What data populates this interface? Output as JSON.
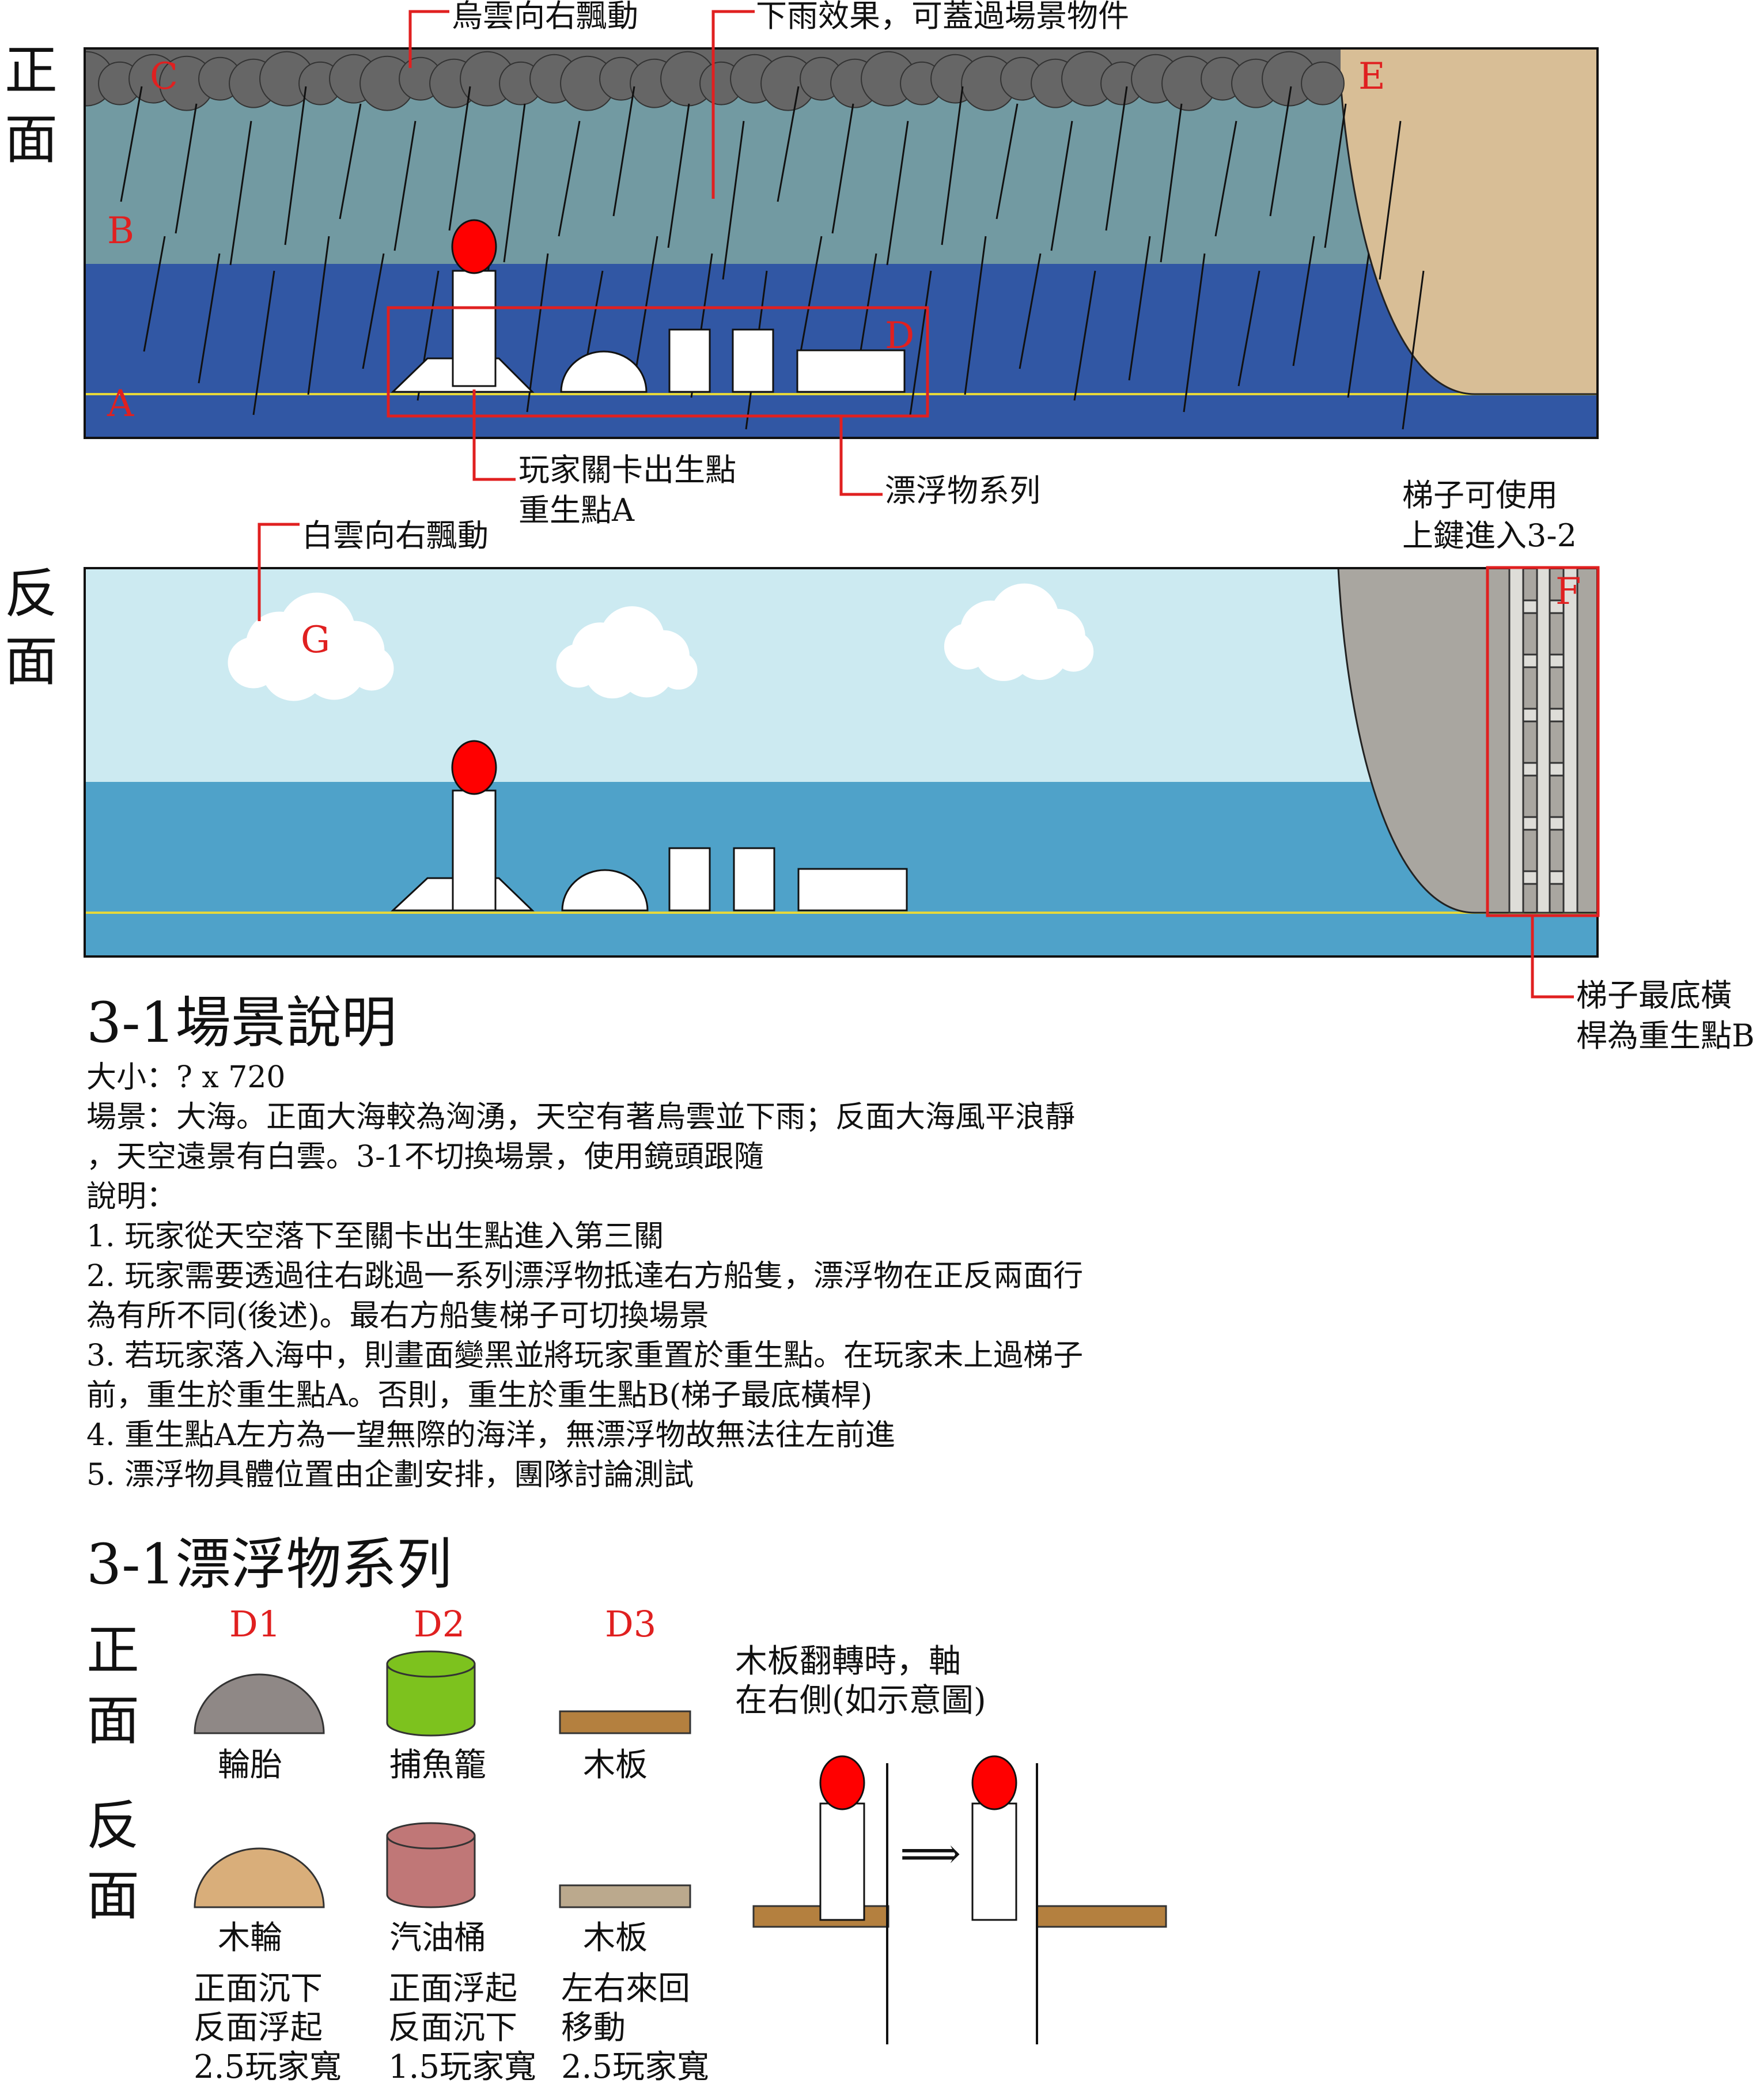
{
  "colors": {
    "front_sky": "#729AA2",
    "front_sea": "#3157A4",
    "cliff_front": "#D8BE96",
    "back_sky": "#CCEAF1",
    "back_sea": "#4FA2C9",
    "cliff_back": "#A9A6A0",
    "dark_cloud": "#666666",
    "marker_red": "#FF0000",
    "label_red": "#E02020",
    "waterline": "#E6D83A",
    "tire": "#8F8886",
    "fish_trap": "#7DC21E",
    "plank_front": "#B4803F",
    "wood_wheel": "#D9AE7A",
    "oil_drum": "#C07777",
    "plank_back": "#BBA98D",
    "ladder": "#DEDDD8"
  },
  "panels": {
    "front": {
      "side_label": [
        "正",
        "面"
      ],
      "letters": {
        "c": "C",
        "e": "E",
        "b": "B",
        "a": "A",
        "d": "D"
      },
      "callouts": {
        "clouds": "烏雲向右飄動",
        "rain": "下雨效果，可蓋過場景物件",
        "spawn_line1": "玩家關卡出生點",
        "spawn_line2": "重生點A",
        "floats": "漂浮物系列"
      }
    },
    "back": {
      "side_label": [
        "反",
        "面"
      ],
      "letters": {
        "g": "G",
        "f": "F"
      },
      "callouts": {
        "clouds": "白雲向右飄動",
        "ladder_use_line1": "梯子可使用",
        "ladder_use_line2": "上鍵進入3-2",
        "ladder_bottom_line1": "梯子最底橫",
        "ladder_bottom_line2": "桿為重生點B"
      }
    }
  },
  "description": {
    "title": "3-1場景說明",
    "lines": [
      "大小：? x 720",
      "場景：大海。正面大海較為洶湧，天空有著烏雲並下雨；反面大海風平浪靜",
      "，天空遠景有白雲。3-1不切換場景，使用鏡頭跟隨",
      "說明：",
      "1. 玩家從天空落下至關卡出生點進入第三關",
      "2. 玩家需要透過往右跳過一系列漂浮物抵達右方船隻，漂浮物在正反兩面行",
      "為有所不同(後述)。最右方船隻梯子可切換場景",
      "3. 若玩家落入海中，則畫面變黑並將玩家重置於重生點。在玩家未上過梯子",
      "前，重生於重生點A。否則，重生於重生點B(梯子最底橫桿)",
      "4. 重生點A左方為一望無際的海洋，無漂浮物故無法往左前進",
      "5. 漂浮物具體位置由企劃安排，團隊討論測試"
    ]
  },
  "floats": {
    "title": "3-1漂浮物系列",
    "front_label": [
      "正",
      "面"
    ],
    "back_label": [
      "反",
      "面"
    ],
    "items": [
      {
        "id": "D1",
        "front": "輪胎",
        "back": "木輪",
        "note": [
          "正面沉下",
          "反面浮起",
          "2.5玩家寬"
        ]
      },
      {
        "id": "D2",
        "front": "捕魚籠",
        "back": "汽油桶",
        "note": [
          "正面浮起",
          "反面沉下",
          "1.5玩家寬"
        ]
      },
      {
        "id": "D3",
        "front": "木板",
        "back": "木板",
        "note": [
          "左右來回",
          "移動",
          "2.5玩家寬"
        ]
      }
    ],
    "flip_note": [
      "木板翻轉時，軸",
      "在右側(如示意圖)"
    ],
    "arrow": "⟹"
  }
}
